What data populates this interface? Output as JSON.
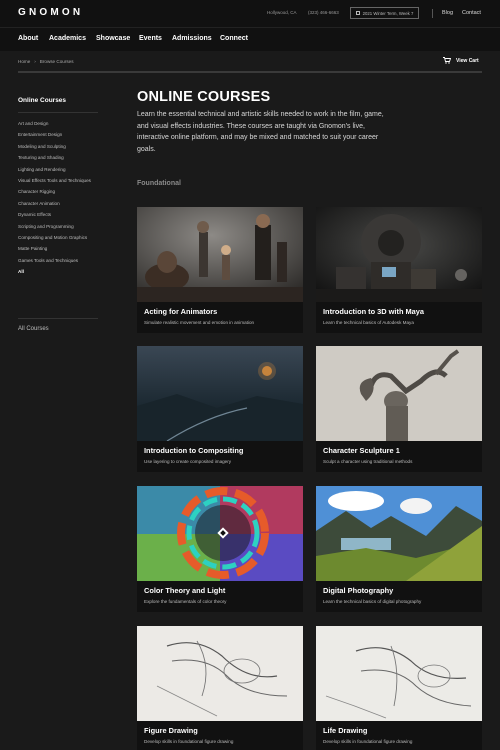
{
  "brand": {
    "logo_text": "GNOMON"
  },
  "top_bar": {
    "location": "Hollywood, CA",
    "phone": "(323) 466-6663",
    "tour_label": "2021 Winter Term, Week 7",
    "links": [
      "Blog",
      "Contact"
    ]
  },
  "nav": {
    "items": [
      "About",
      "Academics",
      "Showcase",
      "Events",
      "Admissions",
      "Connect"
    ]
  },
  "breadcrumb": {
    "items": [
      "Home",
      "Browse Courses"
    ],
    "separator": "›"
  },
  "cart": {
    "label": "View Cart"
  },
  "sidebar": {
    "title": "Online Courses",
    "items": [
      "Art and Design",
      "Entertainment Design",
      "Modeling and Sculpting",
      "Texturing and Shading",
      "Lighting and Rendering",
      "Visual Effects Tools and Techniques",
      "Character Rigging",
      "Character Animation",
      "Dynamic Effects",
      "Scripting and Programming",
      "Compositing and Motion Graphics",
      "Matte Painting",
      "Games Tools and Techniques",
      "All"
    ],
    "active_item": "All",
    "all_courses": "All Courses"
  },
  "main": {
    "title": "ONLINE COURSES",
    "intro": "Learn the essential technical and artistic skills needed to work in the film, game, and visual effects industries. These courses are taught via Gnomon's live, interactive online platform, and may be mixed and matched to suit your career goals.",
    "section_label": "Foundational"
  },
  "courses": [
    {
      "title": "Acting for Animators",
      "subtitle": "Simulate realistic movement and emotion in animation"
    },
    {
      "title": "Introduction to 3D with Maya",
      "subtitle": "Learn the technical basics of Autodesk Maya"
    },
    {
      "title": "Introduction to Compositing",
      "subtitle": "Use layering to create composited imagery"
    },
    {
      "title": "Character Sculpture 1",
      "subtitle": "Sculpt a character using traditional methods"
    },
    {
      "title": "Color Theory and Light",
      "subtitle": "Explore the fundamentals of color theory"
    },
    {
      "title": "Digital Photography",
      "subtitle": "Learn the technical basics of digital photography"
    },
    {
      "title": "Figure Drawing",
      "subtitle": "Develop skills in foundational figure drawing"
    },
    {
      "title": "Life Drawing",
      "subtitle": "Develop skills in foundational figure drawing"
    }
  ],
  "colors": {
    "background": "#1a1a1a",
    "header": "#111111",
    "text": "#ffffff",
    "muted": "#8a8a8a"
  }
}
